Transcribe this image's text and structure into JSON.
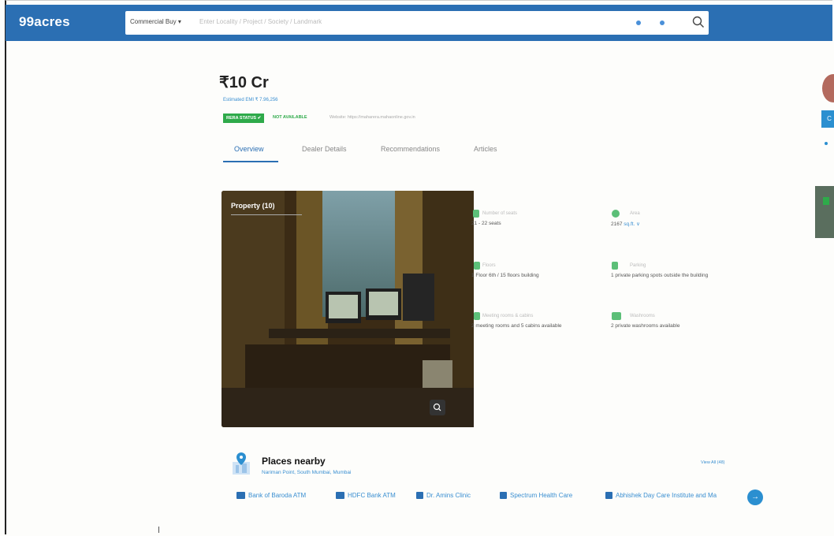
{
  "header": {
    "logo": "99acres",
    "search": {
      "category": "Commercial Buy ▾",
      "placeholder": "Enter Locality / Project / Society / Landmark"
    }
  },
  "property": {
    "price": "₹10 Cr",
    "emi": "Estimated EMI ₹ 7.96,256",
    "rera_status": "RERA STATUS",
    "rera_value": "NOT AVAILABLE",
    "rera_note": "Website: https://maharera.mahaonline.gov.in"
  },
  "tabs": [
    "Overview",
    "Dealer Details",
    "Recommendations",
    "Articles"
  ],
  "photo": {
    "label": "Property (10)"
  },
  "details": [
    {
      "label": "Number of seats",
      "value": "21 - 22 seats"
    },
    {
      "label": "Area",
      "value": "2167",
      "unit": "sq.ft. ∨"
    },
    {
      "label": "Floors",
      "value": "1 Floor 6th / 15 floors building"
    },
    {
      "label": "Parking",
      "value": "1 private parking spots outside the building"
    },
    {
      "label": "Meeting rooms & cabins",
      "value": "2 meeting rooms and 5 cabins available"
    },
    {
      "label": "Washrooms",
      "value": "2 private washrooms available"
    }
  ],
  "places_nearby": {
    "title": "Places nearby",
    "subtitle": "Nariman Point, South Mumbai, Mumbai",
    "view_all": "View All (48)",
    "chips": [
      "Bank of Baroda ATM",
      "HDFC Bank ATM",
      "Dr. Amins Clinic",
      "Spectrum Health Care",
      "Abhishek Day Care Institute and Ma"
    ]
  },
  "colors": {
    "brand": "#2b6fb3",
    "accent": "#2b8fd0",
    "rera_green": "#2eaa4a"
  }
}
